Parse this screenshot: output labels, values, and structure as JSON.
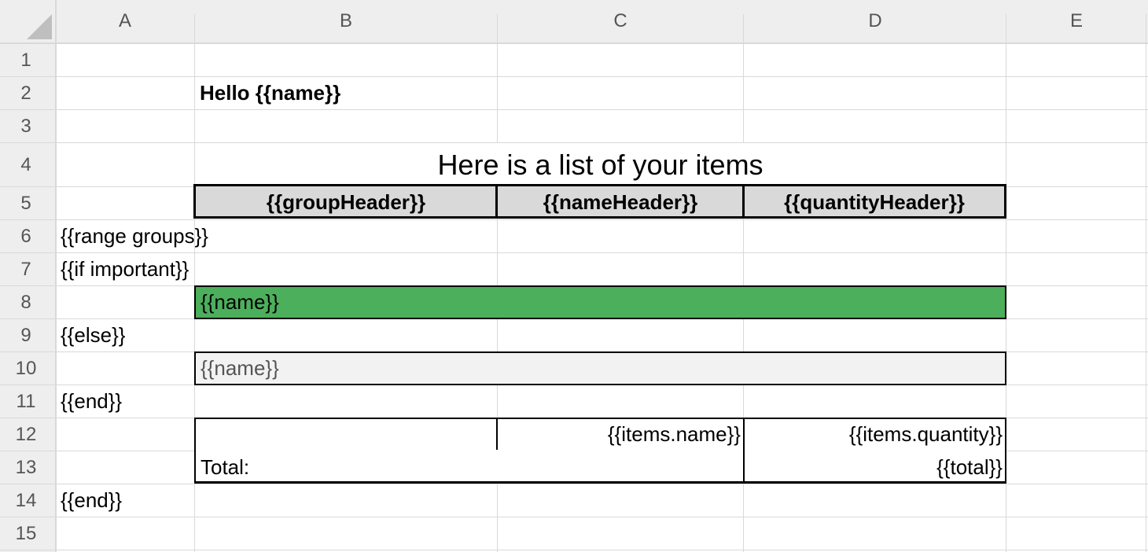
{
  "columns": [
    "A",
    "B",
    "C",
    "D",
    "E"
  ],
  "rows": [
    "1",
    "2",
    "3",
    "4",
    "5",
    "6",
    "7",
    "8",
    "9",
    "10",
    "11",
    "12",
    "13",
    "14",
    "15"
  ],
  "colors": {
    "header_fill": "#d9d9d9",
    "green_fill": "#4caf5c",
    "grey_fill": "#f2f2f2",
    "grey_text": "#555555"
  },
  "cells": {
    "B2": "Hello {{name}}",
    "B4": "Here is a list of your items",
    "B5": "{{groupHeader}}",
    "C5": "{{nameHeader}}",
    "D5": "{{quantityHeader}}",
    "A6": "{{range groups}}",
    "A7": "{{if important}}",
    "B8": "{{name}}",
    "A9": "{{else}}",
    "B10": "{{name}}",
    "A11": "{{end}}",
    "C12": "{{items.name}}",
    "D12": "{{items.quantity}}",
    "B13": "Total:",
    "D13": "{{total}}",
    "A14": "{{end}}"
  }
}
